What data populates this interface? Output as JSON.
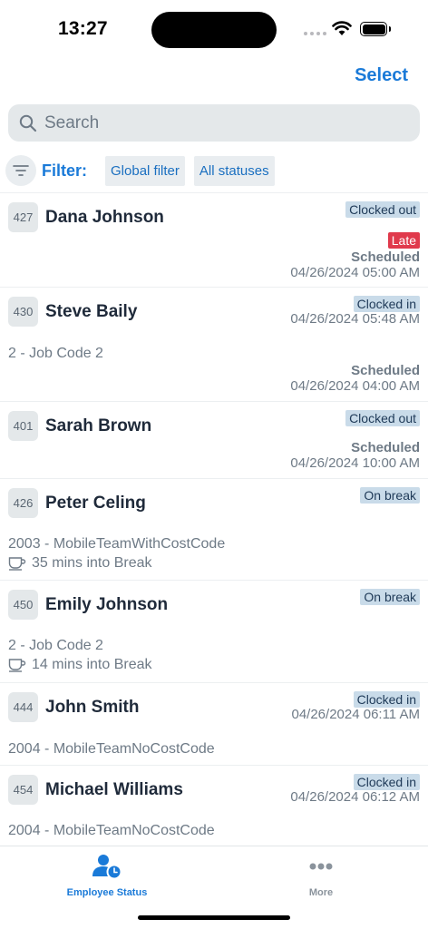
{
  "status_bar": {
    "time": "13:27"
  },
  "header": {
    "select_label": "Select"
  },
  "search": {
    "placeholder": "Search"
  },
  "filter": {
    "label": "Filter:",
    "chips": [
      "Global filter",
      "All statuses"
    ]
  },
  "employees": [
    {
      "id": "427",
      "name": "Dana Johnson",
      "status": "Clocked out",
      "late": "Late",
      "scheduled_label": "Scheduled",
      "scheduled_time": "04/26/2024 05:00 AM"
    },
    {
      "id": "430",
      "name": "Steve Baily",
      "status": "Clocked in",
      "status_time": "04/26/2024 05:48 AM",
      "job": "2 - Job Code 2",
      "scheduled_label": "Scheduled",
      "scheduled_time": "04/26/2024 04:00 AM"
    },
    {
      "id": "401",
      "name": "Sarah Brown",
      "status": "Clocked out",
      "scheduled_label": "Scheduled",
      "scheduled_time": "04/26/2024 10:00 AM"
    },
    {
      "id": "426",
      "name": "Peter Celing",
      "status": "On break",
      "job": "2003 - MobileTeamWithCostCode",
      "break_text": "35 mins into Break"
    },
    {
      "id": "450",
      "name": "Emily Johnson",
      "status": "On break",
      "job": "2 - Job Code 2",
      "break_text": "14 mins into Break"
    },
    {
      "id": "444",
      "name": "John Smith",
      "status": "Clocked in",
      "status_time": "04/26/2024 06:11 AM",
      "job": "2004 - MobileTeamNoCostCode"
    },
    {
      "id": "454",
      "name": "Michael Williams",
      "status": "Clocked in",
      "status_time": "04/26/2024 06:12 AM",
      "job": "2004 - MobileTeamNoCostCode"
    }
  ],
  "tabbar": {
    "employee_status_label": "Employee Status",
    "more_label": "More"
  },
  "colors": {
    "accent": "#1a7ad8",
    "late": "#e03a4c",
    "badge_bg": "#c9dbe9"
  },
  "icons": [
    "search-icon",
    "filter-icon",
    "coffee-cup-icon",
    "employee-clock-icon",
    "more-dots-icon",
    "wifi-icon",
    "battery-icon"
  ]
}
